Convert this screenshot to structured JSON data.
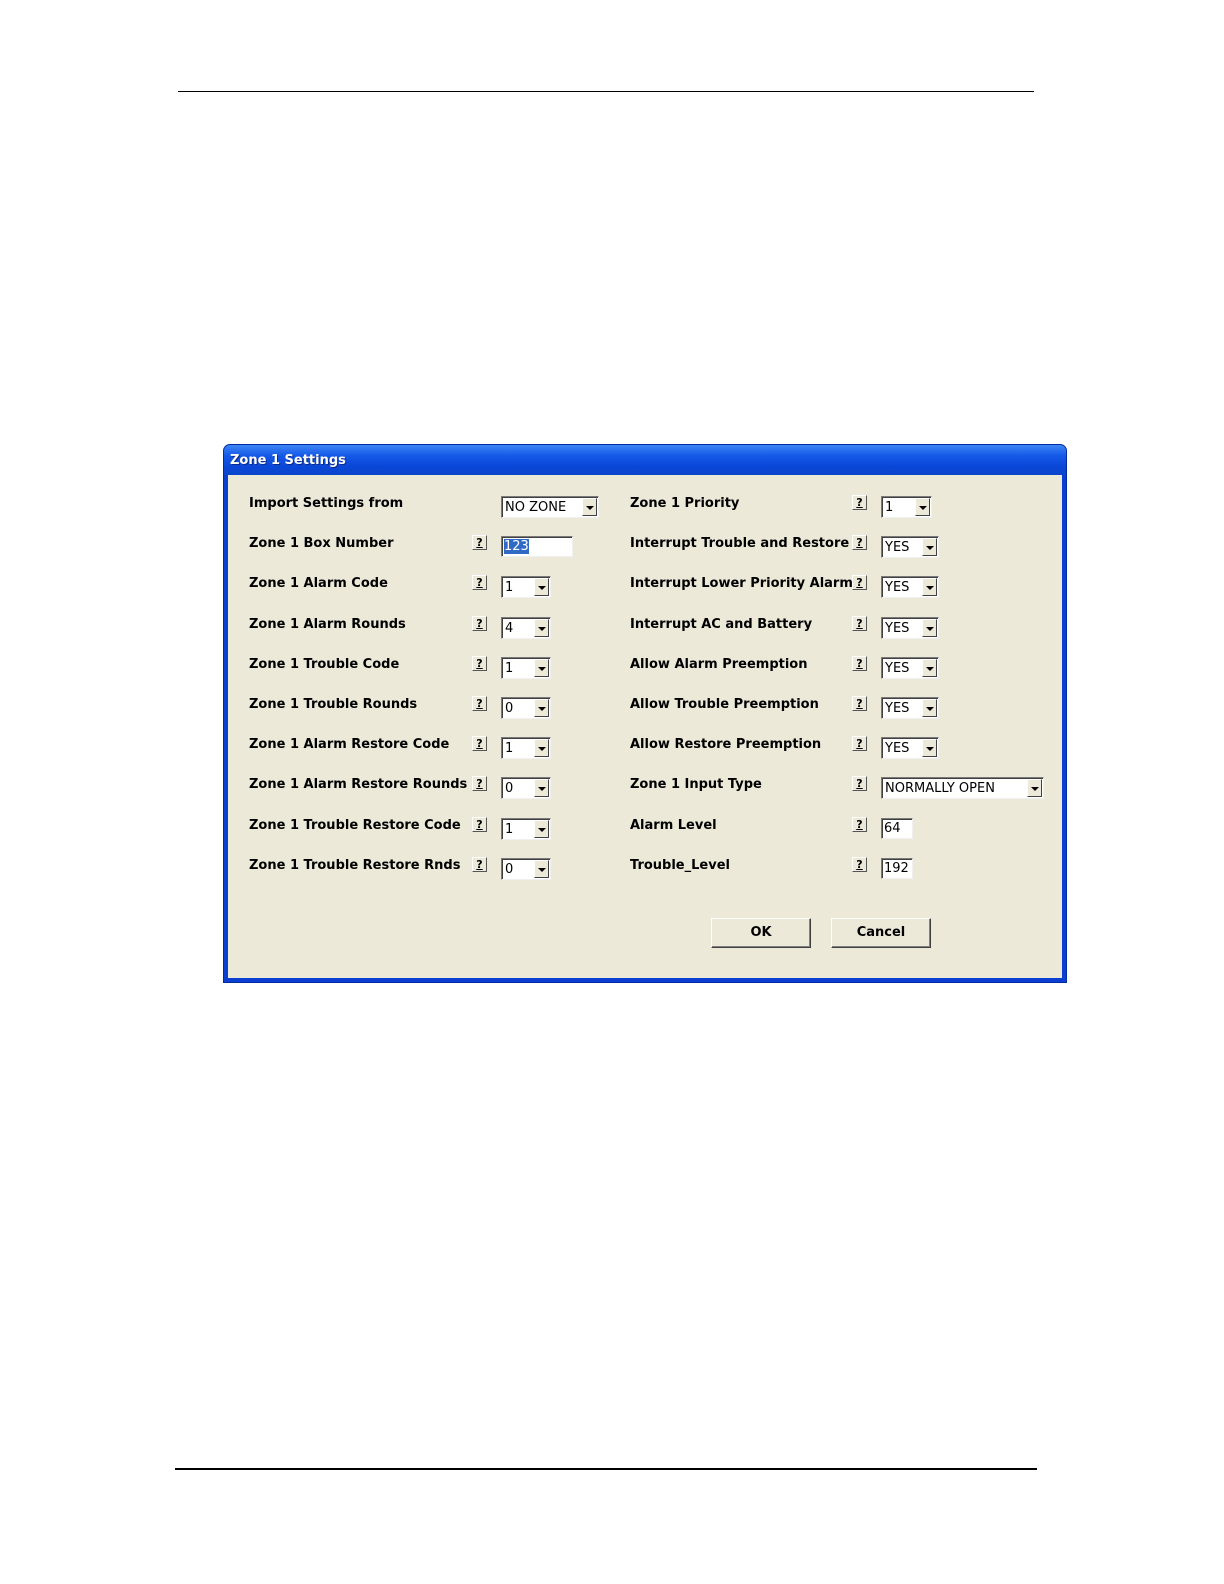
{
  "dialog": {
    "title": "Zone 1 Settings"
  },
  "left_fields": [
    {
      "label": "Import Settings from",
      "type": "combo",
      "value": "NO ZONE",
      "help": false
    },
    {
      "label": "Zone 1 Box Number",
      "type": "text",
      "value": "123",
      "help": true
    },
    {
      "label": "Zone 1 Alarm Code",
      "type": "combo",
      "value": "1",
      "help": true
    },
    {
      "label": "Zone 1 Alarm Rounds",
      "type": "combo",
      "value": "4",
      "help": true
    },
    {
      "label": "Zone 1 Trouble Code",
      "type": "combo",
      "value": "1",
      "help": true
    },
    {
      "label": "Zone 1 Trouble Rounds",
      "type": "combo",
      "value": "0",
      "help": true
    },
    {
      "label": "Zone 1 Alarm Restore Code",
      "type": "combo",
      "value": "1",
      "help": true
    },
    {
      "label": "Zone 1 Alarm Restore Rounds",
      "type": "combo",
      "value": "0",
      "help": true
    },
    {
      "label": "Zone 1 Trouble Restore Code",
      "type": "combo",
      "value": "1",
      "help": true
    },
    {
      "label": "Zone 1 Trouble Restore Rnds",
      "type": "combo",
      "value": "0",
      "help": true
    }
  ],
  "right_fields": [
    {
      "label": "Zone 1 Priority",
      "type": "combo",
      "value": "1",
      "help": true
    },
    {
      "label": "Interrupt Trouble and Restore",
      "type": "combo",
      "value": "YES",
      "help": true
    },
    {
      "label": "Interrupt Lower Priority Alarm",
      "type": "combo",
      "value": "YES",
      "help": true
    },
    {
      "label": "Interrupt AC and Battery",
      "type": "combo",
      "value": "YES",
      "help": true
    },
    {
      "label": "Allow Alarm Preemption",
      "type": "combo",
      "value": "YES",
      "help": true
    },
    {
      "label": "Allow Trouble Preemption",
      "type": "combo",
      "value": "YES",
      "help": true
    },
    {
      "label": "Allow Restore Preemption",
      "type": "combo",
      "value": "YES",
      "help": true
    },
    {
      "label": "Zone 1 Input Type",
      "type": "combo",
      "value": "NORMALLY OPEN",
      "help": true
    },
    {
      "label": "Alarm Level",
      "type": "text",
      "value": "64",
      "help": true
    },
    {
      "label": "Trouble_Level",
      "type": "text",
      "value": "192",
      "help": true
    }
  ],
  "help_glyph": "?",
  "buttons": {
    "ok": "OK",
    "cancel": "Cancel"
  }
}
